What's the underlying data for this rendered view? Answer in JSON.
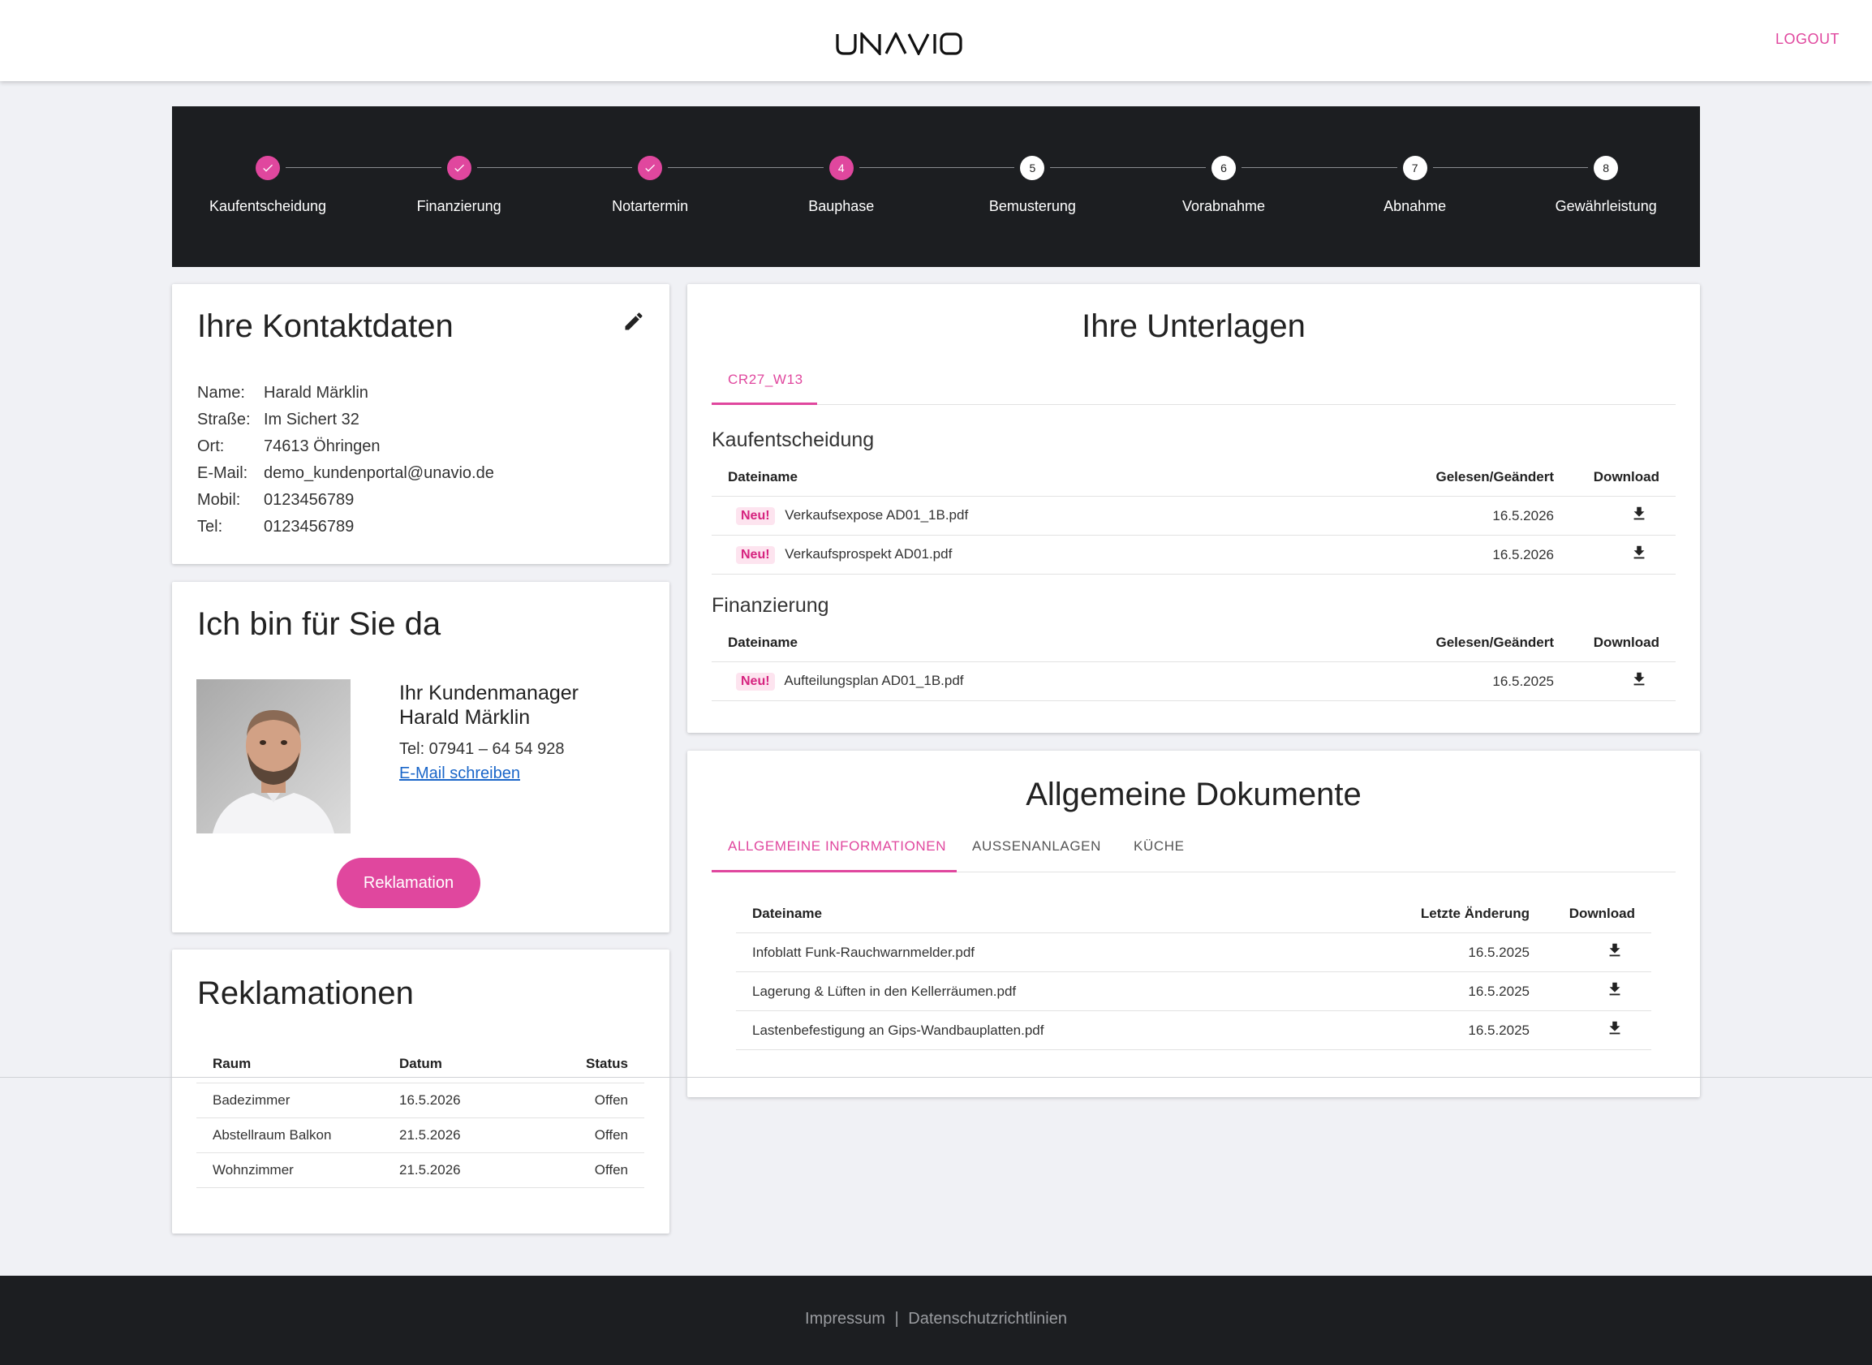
{
  "header": {
    "logo": "UNAVIO",
    "logout_label": "LOGOUT"
  },
  "stepper": {
    "steps": [
      {
        "number": "1",
        "label": "Kaufentscheidung",
        "state": "done"
      },
      {
        "number": "2",
        "label": "Finanzierung",
        "state": "done"
      },
      {
        "number": "3",
        "label": "Notartermin",
        "state": "done"
      },
      {
        "number": "4",
        "label": "Bauphase",
        "state": "active"
      },
      {
        "number": "5",
        "label": "Bemusterung",
        "state": "todo"
      },
      {
        "number": "6",
        "label": "Vorabnahme",
        "state": "todo"
      },
      {
        "number": "7",
        "label": "Abnahme",
        "state": "todo"
      },
      {
        "number": "8",
        "label": "Gewährleistung",
        "state": "todo"
      }
    ]
  },
  "contact": {
    "title": "Ihre Kontaktdaten",
    "rows": [
      {
        "key": "Name:",
        "value": "Harald Märklin"
      },
      {
        "key": "Straße:",
        "value": "Im Sichert 32"
      },
      {
        "key": "Ort:",
        "value": "74613 Öhringen"
      },
      {
        "key": "E-Mail:",
        "value": "demo_kundenportal@unavio.de"
      },
      {
        "key": "Mobil:",
        "value": "0123456789"
      },
      {
        "key": "Tel:",
        "value": "0123456789"
      }
    ]
  },
  "manager": {
    "title": "Ich bin für Sie da",
    "role": "Ihr Kundenmanager",
    "name": "Harald Märklin",
    "phone": "Tel: 07941 – 64 54 928",
    "email_link": "E-Mail schreiben",
    "button_label": "Reklamation"
  },
  "complaints": {
    "title": "Reklamationen",
    "headers": [
      "Raum",
      "Datum",
      "Status"
    ],
    "rows": [
      [
        "Badezimmer",
        "16.5.2026",
        "Offen"
      ],
      [
        "Abstellraum Balkon",
        "21.5.2026",
        "Offen"
      ],
      [
        "Wohnzimmer",
        "21.5.2026",
        "Offen"
      ]
    ]
  },
  "documents": {
    "title": "Ihre Unterlagen",
    "tab": "CR27_W13",
    "new_badge": "Neu!",
    "headers": [
      "Dateiname",
      "Gelesen/Geändert",
      "Download"
    ],
    "sections": [
      {
        "title": "Kaufentscheidung",
        "files": [
          {
            "name": "Verkaufsexpose AD01_1B.pdf",
            "date": "16.5.2026",
            "is_new": true
          },
          {
            "name": "Verkaufsprospekt AD01.pdf",
            "date": "16.5.2026",
            "is_new": true
          }
        ]
      },
      {
        "title": "Finanzierung",
        "files": [
          {
            "name": "Aufteilungsplan AD01_1B.pdf",
            "date": "16.5.2025",
            "is_new": true
          }
        ]
      }
    ]
  },
  "general": {
    "title": "Allgemeine Dokumente",
    "tabs": [
      "ALLGEMEINE INFORMATIONEN",
      "AUSSENANLAGEN",
      "KÜCHE"
    ],
    "active_tab": "ALLGEMEINE INFORMATIONEN",
    "headers": [
      "Dateiname",
      "Letzte Änderung",
      "Download"
    ],
    "files": [
      {
        "name": "Infoblatt Funk-Rauchwarnmelder.pdf",
        "date": "16.5.2025"
      },
      {
        "name": "Lagerung & Lüften in den Kellerräumen.pdf",
        "date": "16.5.2025"
      },
      {
        "name": "Lastenbefestigung an Gips-Wandbauplatten.pdf",
        "date": "16.5.2025"
      }
    ]
  },
  "footer": {
    "impressum": "Impressum",
    "separator": "|",
    "privacy": "Datenschutzrichtlinien"
  },
  "colors": {
    "accent": "#e0479e",
    "dark": "#1c1e21",
    "link": "#1a66c9"
  }
}
